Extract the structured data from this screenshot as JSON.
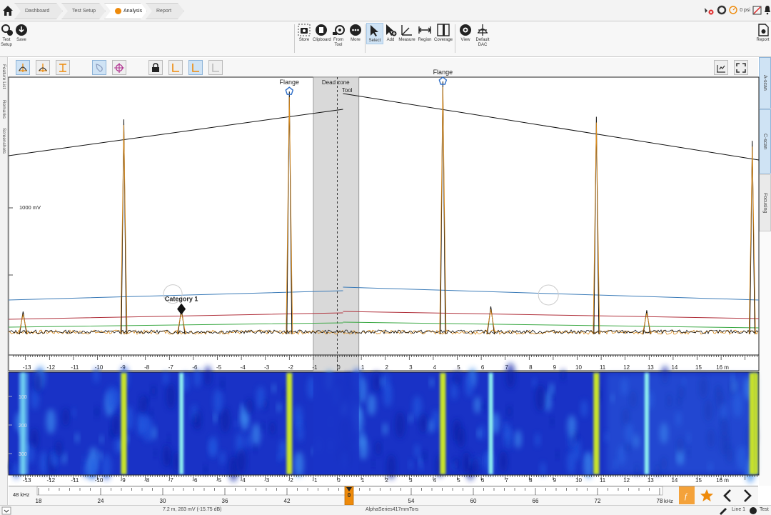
{
  "tabs": [
    {
      "label": "Dashboard"
    },
    {
      "label": "Test Setup"
    },
    {
      "label": "Analysis"
    },
    {
      "label": "Report"
    }
  ],
  "status_icons": {
    "pressure": "0 psi"
  },
  "ribbon": {
    "test_setup": "Test Setup",
    "save": "Save",
    "store": "Store",
    "clipboard": "Clipboard",
    "from_tool": "From Tool",
    "more": "More",
    "select": "Select",
    "add": "Add",
    "measure": "Measure",
    "region": "Region",
    "coverage": "Coverage",
    "view": "View",
    "default_dac": "Default DAC",
    "report": "Report"
  },
  "left_tabs": [
    "Feature List",
    "Remarks",
    "Screenshots"
  ],
  "right_tabs": [
    "A-scan",
    "C-scan",
    "Focusing"
  ],
  "plot": {
    "y_label": "1000 mV",
    "dead_zone_label": "Dead zone",
    "tool_label": "Tool",
    "x_unit": "m",
    "x_ticks": [
      "-13",
      "-12",
      "-11",
      "-10",
      "-9",
      "-8",
      "-7",
      "-6",
      "-5",
      "-4",
      "-3",
      "-2",
      "-1",
      "0",
      "1",
      "2",
      "3",
      "4",
      "5",
      "6",
      "7",
      "8",
      "9",
      "10",
      "11",
      "12",
      "13",
      "14",
      "15",
      "16 m"
    ],
    "annotations": [
      {
        "label": "Flange",
        "x": -2
      },
      {
        "label": "Flange",
        "x": 4.4
      },
      {
        "label": "Category 1",
        "x": -6.5
      }
    ]
  },
  "cscan": {
    "y_ticks": [
      "100",
      "200",
      "300"
    ]
  },
  "frequency_axis": {
    "label": "48 kHz",
    "unit": "kHz",
    "ticks": [
      "18",
      "24",
      "30",
      "36",
      "42",
      "48",
      "54",
      "60",
      "66",
      "72",
      "78"
    ],
    "current": "48",
    "marker_number": "0"
  },
  "statusbar": {
    "left": "7.2 m, 283 mV (-15.75 dB)",
    "center": "AlphaSeries417mmTors",
    "line": "Line 1",
    "test": "Test"
  },
  "colors": {
    "accent": "#ee8a0a",
    "selected": "#cfe3f5",
    "dac_blue": "#3b7bb8",
    "dac_red": "#b0303b",
    "dac_green": "#3aa843",
    "trace_black": "#111111",
    "trace_orange": "#d98a1b",
    "cscan_bg": "#1730c8",
    "cscan_band": "#c8e32a"
  },
  "chart_data": {
    "type": "line",
    "title": "",
    "xlabel": "m",
    "ylabel": "mV",
    "xlim": [
      -13.5,
      17.5
    ],
    "x_ticks": [
      -13,
      -12,
      -11,
      -10,
      -9,
      -8,
      -7,
      -6,
      -5,
      -4,
      -3,
      -2,
      -1,
      0,
      1,
      2,
      3,
      4,
      5,
      6,
      7,
      8,
      9,
      10,
      11,
      12,
      13,
      14,
      15,
      16
    ],
    "peaks": [
      {
        "x": -8.9,
        "y": 1700,
        "series": "Signal"
      },
      {
        "x": -2.0,
        "y": 1920,
        "series": "Signal",
        "label": "Flange"
      },
      {
        "x": 4.4,
        "y": 2000,
        "series": "Signal",
        "label": "Flange"
      },
      {
        "x": 10.8,
        "y": 1720,
        "series": "Signal"
      },
      {
        "x": 17.3,
        "y": 1530,
        "series": "Signal"
      },
      {
        "x": -13.1,
        "y": 180,
        "series": "Signal"
      },
      {
        "x": -6.5,
        "y": 200,
        "series": "Signal",
        "label": "Category 1"
      },
      {
        "x": 6.4,
        "y": 220,
        "series": "Signal"
      },
      {
        "x": 12.9,
        "y": 190,
        "series": "Signal"
      }
    ],
    "dead_zone": [
      -1.0,
      0.9
    ]
  }
}
